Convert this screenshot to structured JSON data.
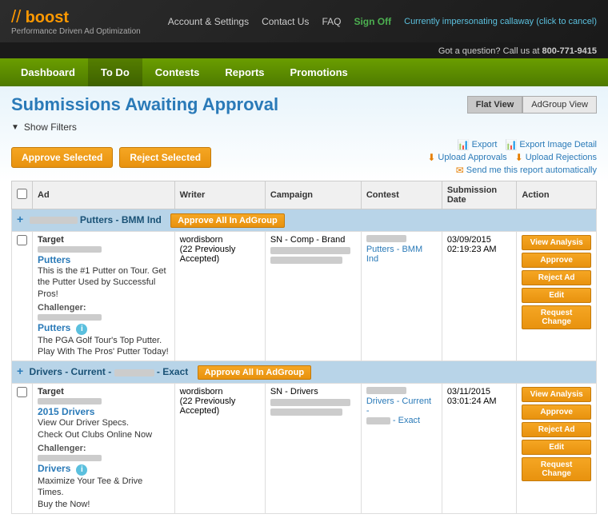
{
  "header": {
    "logo": "boost",
    "tagline": "Performance Driven Ad Optimization",
    "nav": [
      {
        "label": "Account & Settings",
        "href": "#"
      },
      {
        "label": "Contact Us",
        "href": "#"
      },
      {
        "label": "FAQ",
        "href": "#"
      },
      {
        "label": "Sign Off",
        "href": "#",
        "class": "signoff"
      }
    ],
    "impersonate": "Currently impersonating callaway (click to cancel)",
    "phone_label": "Got a question? Call us at",
    "phone": "800-771-9415"
  },
  "main_nav": [
    {
      "label": "Dashboard",
      "href": "#"
    },
    {
      "label": "To Do",
      "href": "#",
      "active": true
    },
    {
      "label": "Contests",
      "href": "#"
    },
    {
      "label": "Reports",
      "href": "#"
    },
    {
      "label": "Promotions",
      "href": "#"
    }
  ],
  "page": {
    "title": "Submissions Awaiting Approval",
    "view_buttons": [
      {
        "label": "Flat View",
        "active": true
      },
      {
        "label": "AdGroup View",
        "active": false
      }
    ],
    "show_filters": "Show Filters",
    "buttons": {
      "approve_selected": "Approve Selected",
      "reject_selected": "Reject Selected"
    },
    "action_links": [
      {
        "icon": "↓",
        "label": "Export"
      },
      {
        "icon": "↓",
        "label": "Export Image Detail"
      },
      {
        "icon": "↓",
        "label": "Upload Approvals"
      },
      {
        "icon": "↓",
        "label": "Upload Rejections"
      },
      {
        "icon": "✉",
        "label": "Send me this report automatically"
      }
    ]
  },
  "table": {
    "headers": [
      "",
      "Ad",
      "Writer",
      "Campaign",
      "Contest",
      "Submission Date",
      "Action"
    ],
    "groups": [
      {
        "name": "Putters - BMM Ind",
        "approve_all_label": "Approve All In AdGroup",
        "rows": [
          {
            "target_label": "Target",
            "ad_title": "Putters",
            "ad_desc_1": "This is the #1 Putter on Tour. Get",
            "ad_desc_2": "the Putter Used by Successful Pros!",
            "challenger_label": "Challenger:",
            "challenger_title": "Putters",
            "challenger_desc_1": "The PGA Golf Tour's Top Putter.",
            "challenger_desc_2": "Play With The Pros' Putter Today!",
            "writer": "wordisborn",
            "writer_note": "(22 Previously Accepted)",
            "campaign": "SN - Comp - Brand",
            "contest": "Putters - BMM Ind",
            "submission_date": "03/09/2015",
            "submission_time": "02:19:23 AM",
            "actions": [
              "View Analysis",
              "Approve",
              "Reject Ad",
              "Edit",
              "Request Change"
            ]
          }
        ]
      },
      {
        "name": "Drivers - Current - Exact",
        "approve_all_label": "Approve All In AdGroup",
        "rows": [
          {
            "target_label": "Target",
            "ad_title": "2015 Drivers",
            "ad_desc_1": "View Our Driver Specs.",
            "ad_desc_2": "Check Out Clubs Online Now",
            "challenger_label": "Challenger:",
            "challenger_title": "Drivers",
            "challenger_desc_1": "Maximize Your Tee & Drive Times.",
            "challenger_desc_2": "Buy the Now!",
            "writer": "wordisborn",
            "writer_note": "(22 Previously Accepted)",
            "campaign": "SN - Drivers",
            "contest": "Drivers - Current - Exact",
            "submission_date": "03/11/2015",
            "submission_time": "03:01:24 AM",
            "actions": [
              "View Analysis",
              "Approve",
              "Reject Ad",
              "Edit",
              "Request Change"
            ]
          }
        ]
      }
    ]
  }
}
